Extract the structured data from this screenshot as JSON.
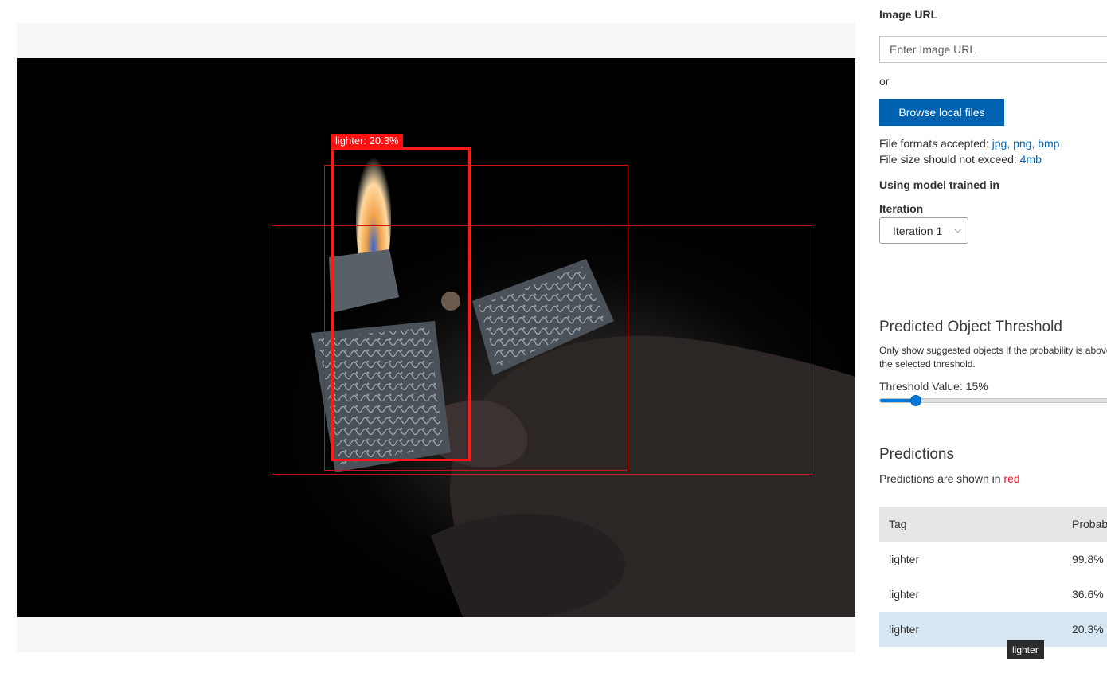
{
  "image_label": "lighter: 20.3%",
  "form": {
    "image_url_label": "Image URL",
    "image_url_placeholder": "Enter Image URL",
    "or_text": "or",
    "browse_button": "Browse local files",
    "formats_prefix": "File formats accepted: ",
    "formats": "jpg, png, bmp",
    "size_prefix": "File size should not exceed: ",
    "size": "4mb",
    "model_label": "Using model trained in",
    "iteration_label": "Iteration",
    "iteration_selected": "Iteration 1"
  },
  "threshold": {
    "title": "Predicted Object Threshold",
    "description": "Only show suggested objects if the probability is above the selected threshold.",
    "value_label": "Threshold Value: 15%",
    "value_fraction": 0.15
  },
  "predictions": {
    "title": "Predictions",
    "note_prefix": "Predictions are shown in ",
    "note_color_word": "red",
    "columns": [
      "Tag",
      "Probability"
    ],
    "rows": [
      {
        "tag": "lighter",
        "probability": "99.8%"
      },
      {
        "tag": "lighter",
        "probability": "36.6%"
      },
      {
        "tag": "lighter",
        "probability": "20.3%"
      }
    ]
  },
  "tooltip": "lighter",
  "colors": {
    "accent": "#0063b1",
    "box": "#ff1a1a"
  }
}
